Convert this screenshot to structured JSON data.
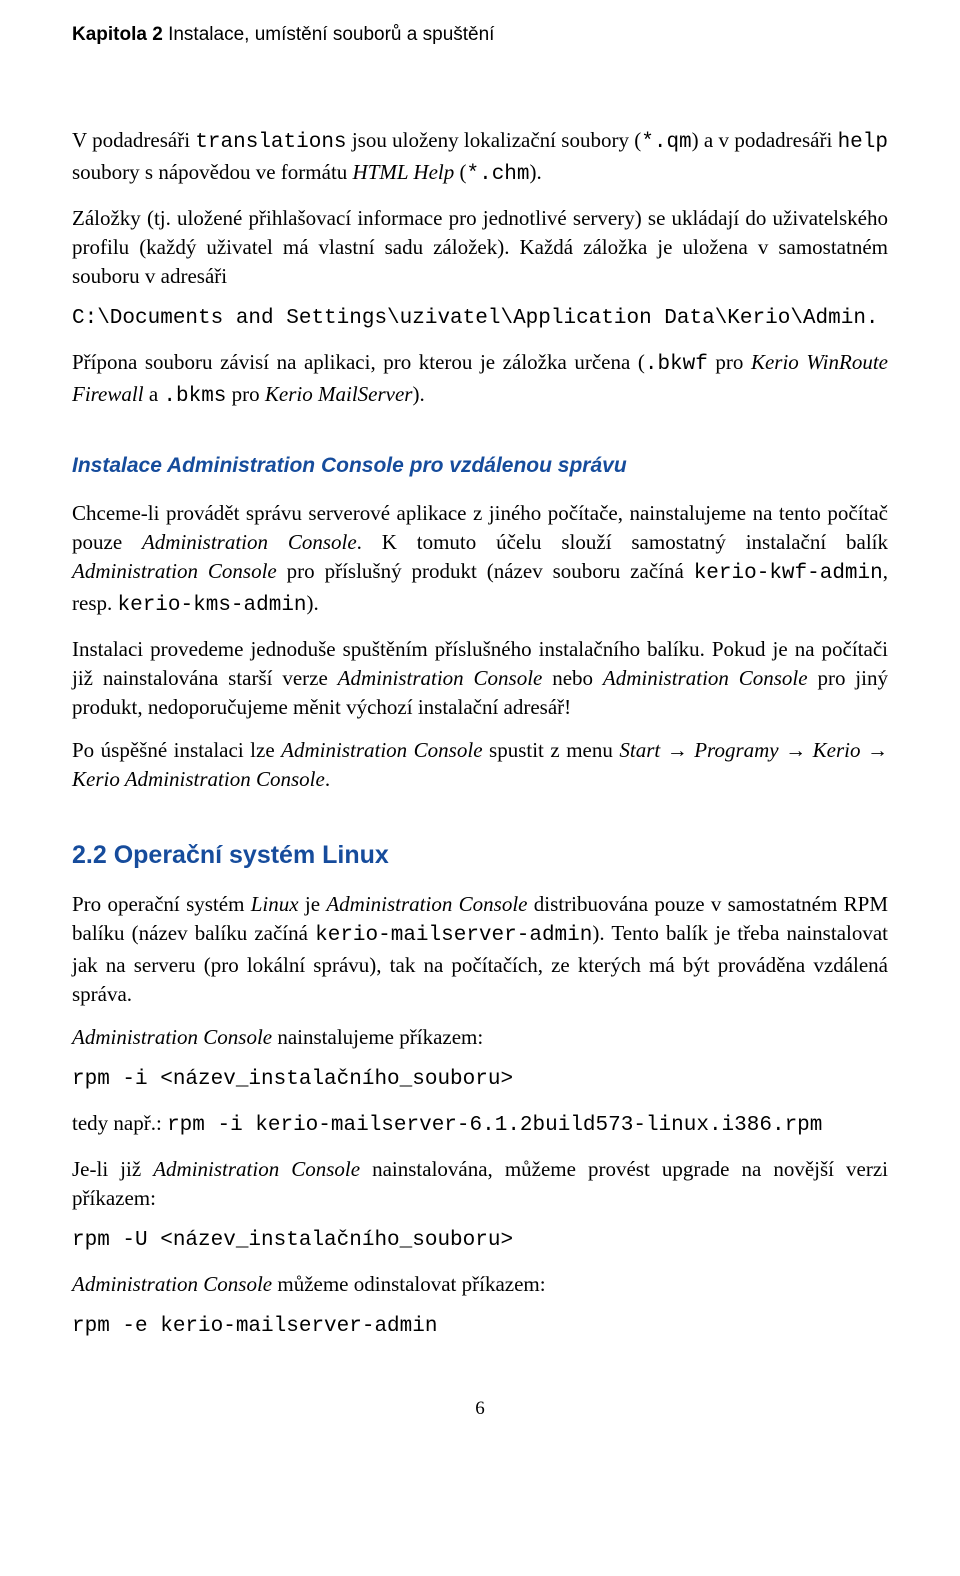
{
  "header": {
    "chapter": "Kapitola 2",
    "title": " Instalace, umístění souborů a spuštění"
  },
  "p1": {
    "t1": "V podadresáři ",
    "t2": "translations",
    "t3": " jsou uloženy lokalizační soubory (",
    "t4": "*.qm",
    "t5": ") a v podadresáři ",
    "t6": "help",
    "t7": " soubory s nápovědou ve formátu ",
    "t8": "HTML Help",
    "t9": " (",
    "t10": "*.chm",
    "t11": ")."
  },
  "p2": {
    "t1": "Záložky (tj. uložené přihlašovací informace pro jednotlivé servery) se ukládají do uživatelského profilu (každý uživatel má vlastní sadu záložek). Každá záložka je uložena v samostatném souboru v adresáři"
  },
  "code1": "C:\\Documents and Settings\\uzivatel\\Application Data\\Kerio\\Admin.",
  "p3": {
    "t1": "Přípona souboru závisí na aplikaci, pro kterou je záložka určena (",
    "t2": ".bkwf",
    "t3": " pro ",
    "t4": "Kerio WinRoute Firewall",
    "t5": " a ",
    "t6": ".bkms",
    "t7": " pro ",
    "t8": "Kerio MailServer",
    "t9": ")."
  },
  "h_remote": "Instalace Administration Console pro vzdálenou správu",
  "p4": {
    "t1": "Chceme-li provádět správu serverové aplikace z jiného počítače, nainstalujeme na tento počítač pouze ",
    "t2": "Administration Console",
    "t3": ". K tomuto účelu slouží samostatný instalační balík ",
    "t4": "Administration Console",
    "t5": " pro příslušný produkt (název souboru začíná ",
    "t6": "kerio-kwf-admin",
    "t7": ", resp. ",
    "t8": "kerio-kms-admin",
    "t9": ")."
  },
  "p5": {
    "t1": "Instalaci provedeme jednoduše spuštěním příslušného instalačního balíku. Pokud je na počítači již nainstalována starší verze ",
    "t2": "Administration Console",
    "t3": " nebo ",
    "t4": "Administration Console",
    "t5": " pro jiný produkt, nedoporučujeme měnit výchozí instalační adresář!"
  },
  "p6": {
    "t1": "Po úspěšné instalaci lze ",
    "t2": "Administration Console",
    "t3": " spustit z menu ",
    "t4": "Start",
    "t5": " → ",
    "t6": "Programy",
    "t7": " → ",
    "t8": "Kerio",
    "t9": " → ",
    "t10": "Kerio Administration Console",
    "t11": "."
  },
  "h_linux": "2.2 Operační systém Linux",
  "p7": {
    "t1": "Pro operační systém ",
    "t2": "Linux",
    "t3": " je ",
    "t4": "Administration Console",
    "t5": " distribuována pouze v samostatném RPM balíku (název balíku začíná ",
    "t6": "kerio-mailserver-admin",
    "t7": "). Tento balík je třeba nainstalovat jak na serveru (pro lokální správu), tak na počítačích, ze kterých má být prováděna vzdálená správa."
  },
  "p8": {
    "t1": "Administration Console",
    "t2": " nainstalujeme příkazem:"
  },
  "code2": "rpm -i <název_instalačního_souboru>",
  "p9": {
    "t1": "tedy např.: ",
    "t2": "rpm -i kerio-mailserver-6.1.2build573-linux.i386.rpm"
  },
  "p10": {
    "t1": "Je-li již ",
    "t2": "Administration Console",
    "t3": " nainstalována, můžeme provést upgrade na novější verzi příkazem:"
  },
  "code3": "rpm -U <název_instalačního_souboru>",
  "p11": {
    "t1": "Administration Console",
    "t2": " můžeme odinstalovat příkazem:"
  },
  "code4": "rpm -e kerio-mailserver-admin",
  "page_num": "6"
}
